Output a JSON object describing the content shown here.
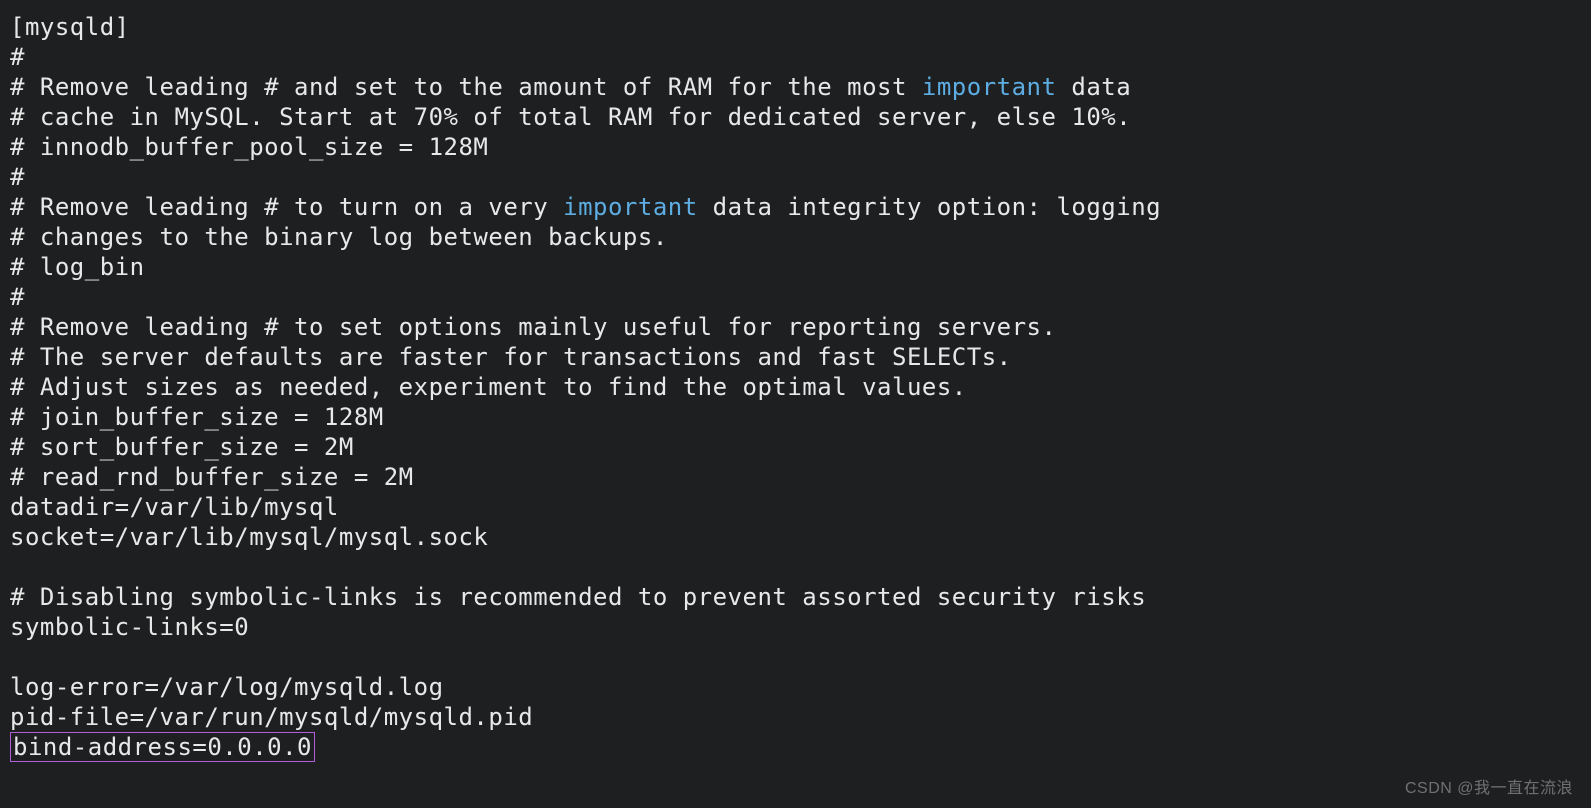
{
  "lines": {
    "l0": "[mysqld]",
    "l1": "#",
    "l2a": "# Remove leading # and set to the amount of RAM for the most ",
    "l2b": "important",
    "l2c": " data",
    "l3": "# cache in MySQL. Start at 70% of total RAM for dedicated server, else 10%.",
    "l4": "# innodb_buffer_pool_size = 128M",
    "l5": "#",
    "l6a": "# Remove leading # to turn on a very ",
    "l6b": "important",
    "l6c": " data integrity option: logging",
    "l7": "# changes to the binary log between backups.",
    "l8": "# log_bin",
    "l9": "#",
    "l10": "# Remove leading # to set options mainly useful for reporting servers.",
    "l11": "# The server defaults are faster for transactions and fast SELECTs.",
    "l12": "# Adjust sizes as needed, experiment to find the optimal values.",
    "l13": "# join_buffer_size = 128M",
    "l14": "# sort_buffer_size = 2M",
    "l15": "# read_rnd_buffer_size = 2M",
    "l16": "datadir=/var/lib/mysql",
    "l17": "socket=/var/lib/mysql/mysql.sock",
    "l18": "",
    "l19": "# Disabling symbolic-links is recommended to prevent assorted security risks",
    "l20": "symbolic-links=0",
    "l21": "",
    "l22": "log-error=/var/log/mysqld.log",
    "l23": "pid-file=/var/run/mysqld/mysqld.pid",
    "l24": "bind-address=0.0.0.0"
  },
  "watermark": "CSDN @我一直在流浪"
}
